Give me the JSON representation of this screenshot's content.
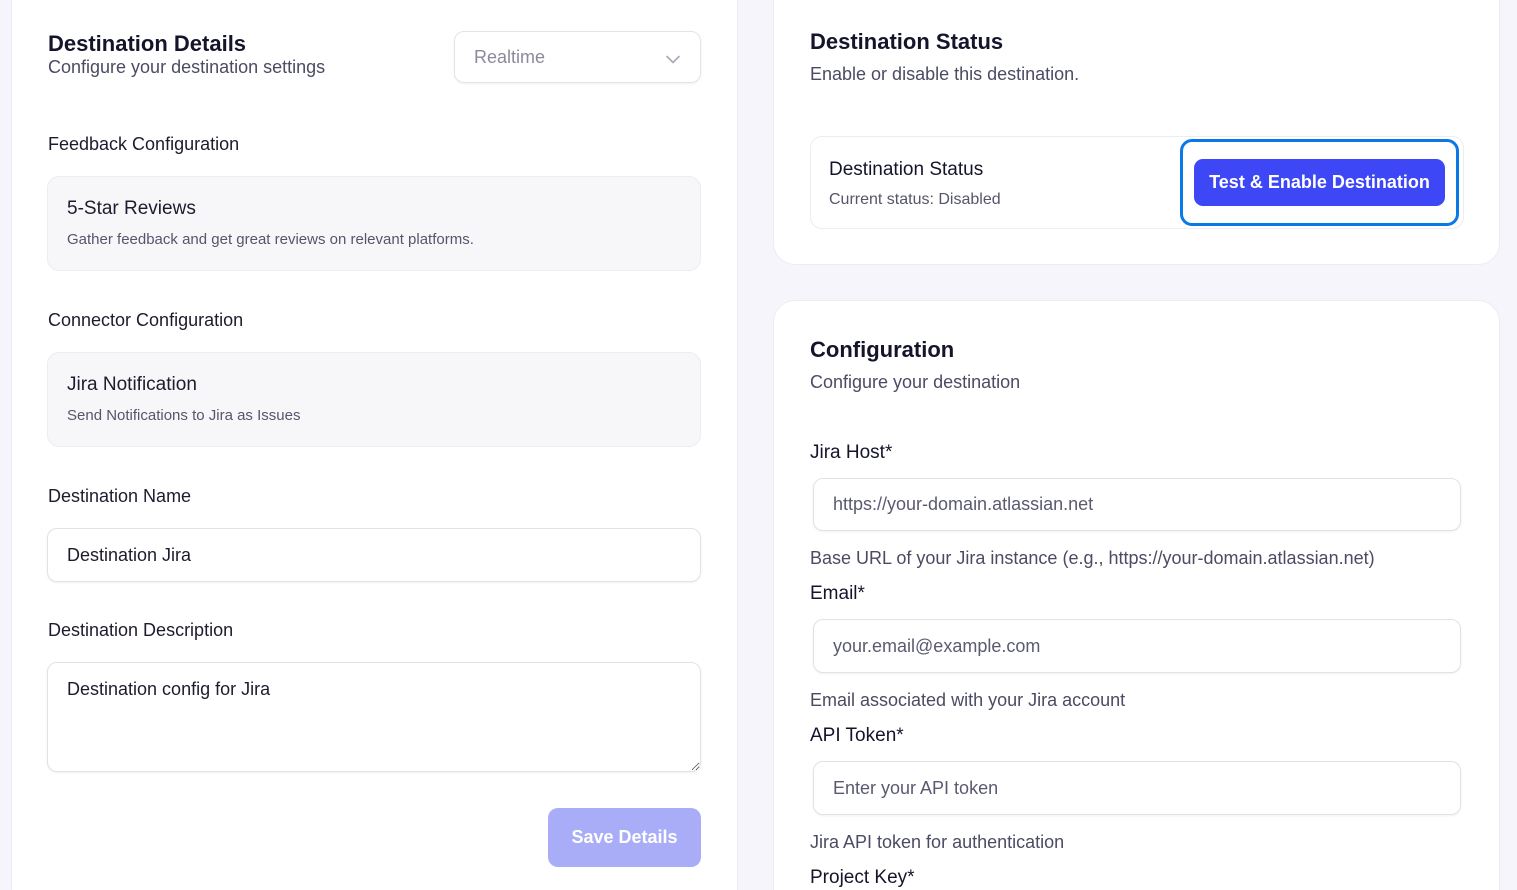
{
  "details": {
    "title": "Destination Details",
    "subtitle": "Configure your destination settings",
    "mode_select": {
      "value": "Realtime",
      "icon": "chevron-down-icon"
    },
    "feedback": {
      "label": "Feedback Configuration",
      "title": "5-Star Reviews",
      "description": "Gather feedback and get great reviews on relevant platforms."
    },
    "connector": {
      "label": "Connector Configuration",
      "title": "Jira Notification",
      "description": "Send Notifications to Jira as Issues"
    },
    "name": {
      "label": "Destination Name",
      "value": "Destination Jira"
    },
    "description": {
      "label": "Destination Description",
      "value": "Destination config for Jira"
    },
    "save_label": "Save Details"
  },
  "status": {
    "title": "Destination Status",
    "subtitle": "Enable or disable this destination.",
    "row_title": "Destination Status",
    "row_status": "Current status: Disabled",
    "enable_label": "Test & Enable Destination"
  },
  "config": {
    "title": "Configuration",
    "subtitle": "Configure your destination",
    "host": {
      "label": "Jira Host*",
      "placeholder": "https://your-domain.atlassian.net",
      "help": "Base URL of your Jira instance (e.g., https://your-domain.atlassian.net)"
    },
    "email": {
      "label": "Email*",
      "placeholder": "your.email@example.com",
      "help": "Email associated with your Jira account"
    },
    "token": {
      "label": "API Token*",
      "placeholder": "Enter your API token",
      "help": "Jira API token for authentication"
    },
    "project_label": "Project Key*"
  },
  "colors": {
    "primary": "#3d47f5",
    "primary_disabled": "#a9adf7",
    "focus_ring": "#0a78e6",
    "background": "#f5f5fb"
  }
}
